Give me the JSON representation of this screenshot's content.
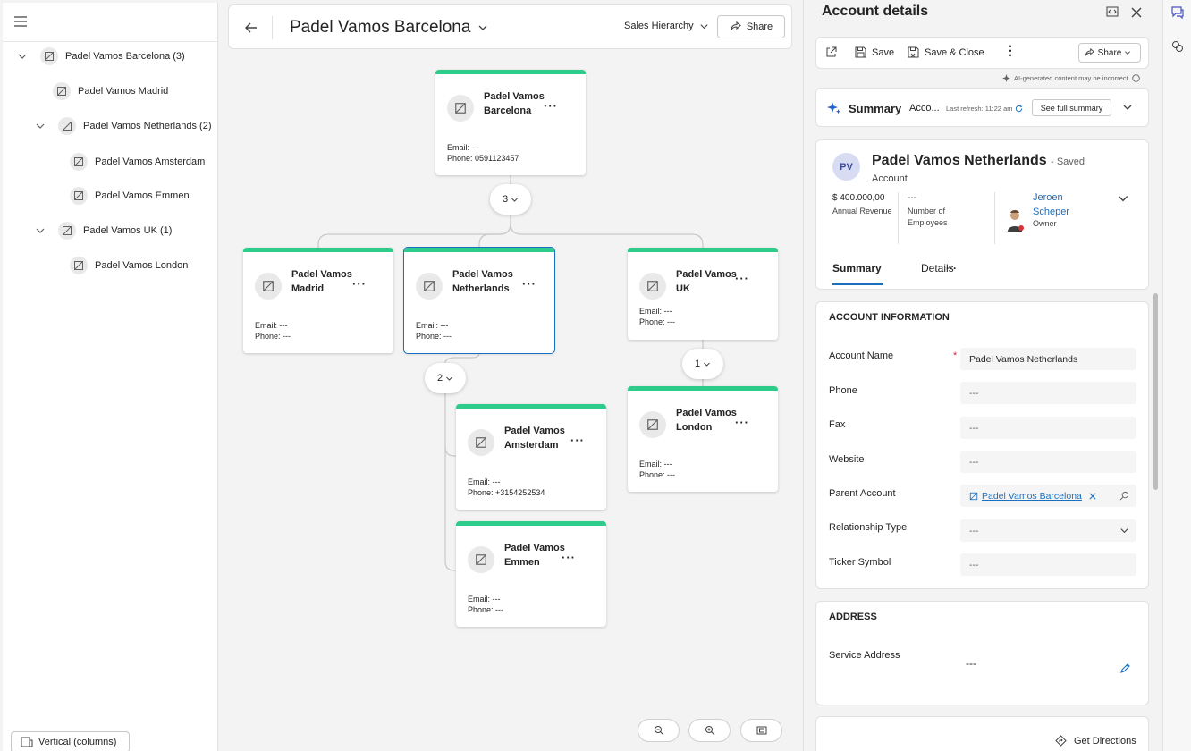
{
  "tree": {
    "items": [
      {
        "label": "Padel Vamos Barcelona (3)",
        "expanded": true
      },
      {
        "label": "Padel Vamos Madrid"
      },
      {
        "label": "Padel Vamos Netherlands (2)",
        "expanded": true
      },
      {
        "label": "Padel Vamos Amsterdam"
      },
      {
        "label": "Padel Vamos Emmen"
      },
      {
        "label": "Padel Vamos UK (1)",
        "expanded": true
      },
      {
        "label": "Padel Vamos London"
      }
    ],
    "view_toggle": "Vertical (columns)"
  },
  "header": {
    "title": "Padel Vamos Barcelona",
    "hierarchy": "Sales Hierarchy",
    "share": "Share"
  },
  "cards": {
    "barcelona": {
      "name": "Padel Vamos Barcelona",
      "email": "Email: ---",
      "phone": "Phone: 0591123457"
    },
    "madrid": {
      "name": "Padel Vamos Madrid",
      "email": "Email: ---",
      "phone": "Phone: ---"
    },
    "netherlands": {
      "name": "Padel Vamos Netherlands",
      "email": "Email: ---",
      "phone": "Phone: ---"
    },
    "uk": {
      "name": "Padel Vamos UK",
      "email": "Email: ---",
      "phone": "Phone: ---"
    },
    "london": {
      "name": "Padel Vamos London",
      "email": "Email: ---",
      "phone": "Phone: ---"
    },
    "amsterdam": {
      "name": "Padel Vamos Amsterdam",
      "email": "Email: ---",
      "phone": "Phone: +3154252534"
    },
    "emmen": {
      "name": "Padel Vamos Emmen",
      "email": "Email: ---",
      "phone": "Phone: ---"
    }
  },
  "counts": {
    "barcelona": "3",
    "netherlands": "2",
    "uk": "1"
  },
  "details": {
    "title": "Account details",
    "toolbar": {
      "save": "Save",
      "save_close": "Save & Close",
      "share": "Share"
    },
    "ai_note": "AI-generated content may be incorrect",
    "summary": {
      "title": "Summary",
      "acc": "Acco...",
      "refresh": "Last refresh: 11:22 am",
      "see_full": "See full summary"
    },
    "record": {
      "initials": "PV",
      "name": "Padel Vamos Netherlands",
      "saved": "- Saved",
      "type": "Account",
      "revenue_value": "$ 400.000,00",
      "revenue_label": "Annual Revenue",
      "employees_value": "---",
      "employees_label": "Number of Employees",
      "owner_name": "Jeroen Scheper",
      "owner_label": "Owner"
    },
    "tabs": [
      "Summary",
      "Details",
      "···"
    ],
    "account_info": {
      "title": "ACCOUNT INFORMATION",
      "fields": [
        {
          "label": "Account Name",
          "value": "Padel Vamos Netherlands"
        },
        {
          "label": "Phone",
          "value": "---"
        },
        {
          "label": "Fax",
          "value": "---"
        },
        {
          "label": "Website",
          "value": "---"
        },
        {
          "label": "Parent Account",
          "value": "Padel Vamos Barcelona"
        },
        {
          "label": "Relationship Type",
          "value": "---"
        },
        {
          "label": "Ticker Symbol",
          "value": "---"
        }
      ]
    },
    "address": {
      "title": "ADDRESS",
      "service_label": "Service Address",
      "service_value": "---",
      "directions": "Get Directions"
    }
  },
  "colors": {
    "accent": "#2ecc8a",
    "link": "#1b6fbf",
    "selected": "#1b6fbf"
  }
}
